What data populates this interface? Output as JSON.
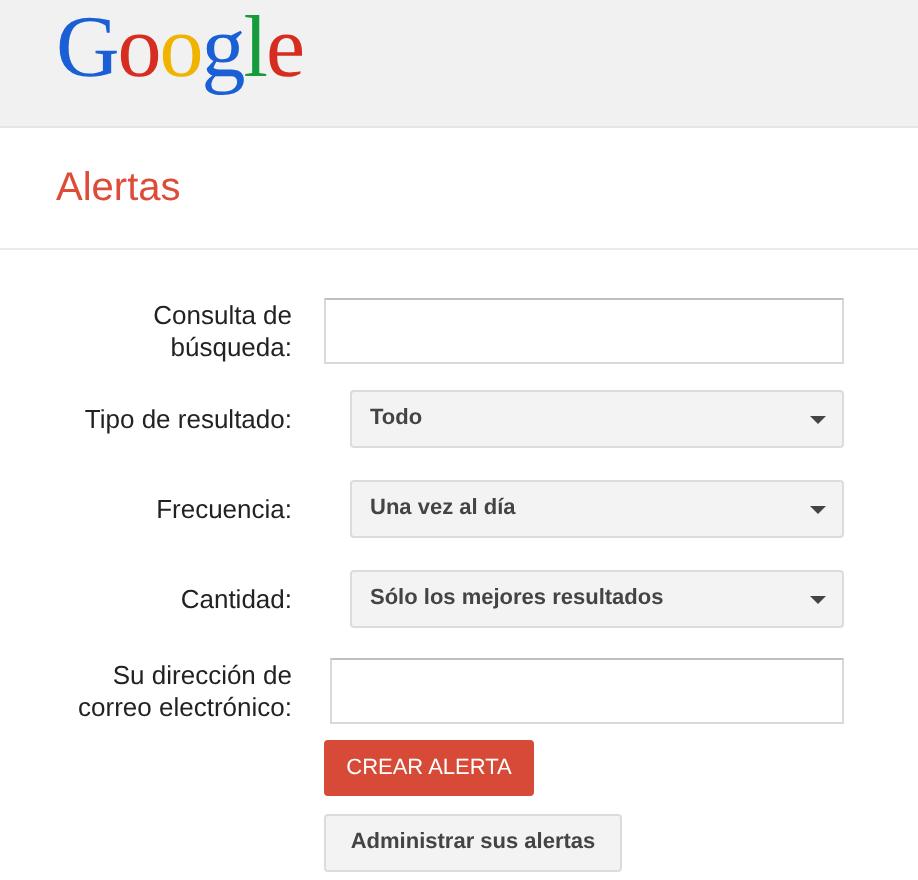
{
  "header": {
    "logo": "Google"
  },
  "page_title": "Alertas",
  "form": {
    "fields": [
      {
        "kind": "text",
        "label": "Consulta de\nbúsqueda:"
      },
      {
        "kind": "select",
        "label": "Tipo de resultado:",
        "value": "Todo"
      },
      {
        "kind": "select",
        "label": "Frecuencia:",
        "value": "Una vez al día"
      },
      {
        "kind": "select",
        "label": "Cantidad:",
        "value": "Sólo los mejores resultados"
      },
      {
        "kind": "text",
        "label": "Su dirección de\ncorreo electrónico:"
      }
    ],
    "buttons": [
      {
        "kind": "primary",
        "label": "CREAR ALERTA"
      },
      {
        "kind": "secondary",
        "label": "Administrar sus alertas"
      }
    ]
  }
}
